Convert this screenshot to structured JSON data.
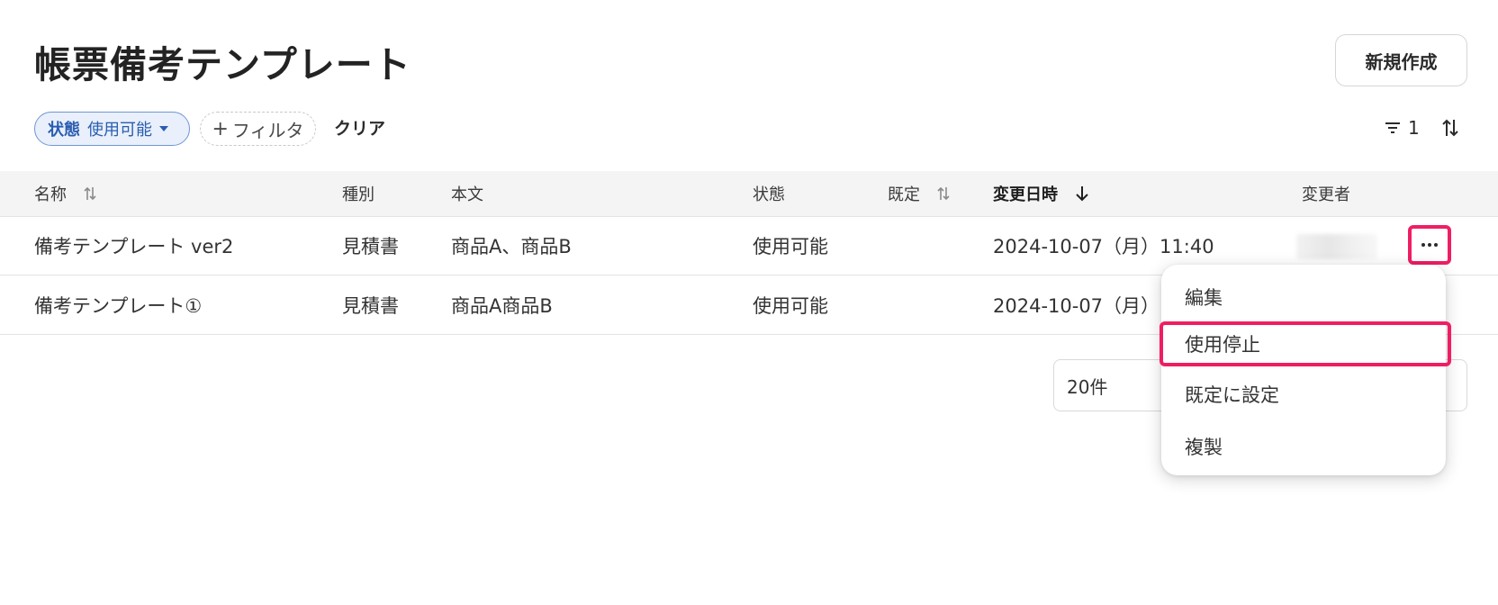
{
  "header": {
    "title": "帳票備考テンプレート",
    "new_button": "新規作成"
  },
  "filters": {
    "chip_key": "状態",
    "chip_value": "使用可能",
    "add_filter": "フィルタ",
    "clear": "クリア",
    "active_count": "1"
  },
  "table": {
    "columns": [
      "名称",
      "種別",
      "本文",
      "状態",
      "既定",
      "変更日時",
      "変更者"
    ],
    "rows": [
      {
        "name": "備考テンプレート ver2",
        "type": "見積書",
        "body": "商品A、商品B",
        "status": "使用可能",
        "default": "",
        "updated": "2024-10-07（月）11:40"
      },
      {
        "name": "備考テンプレート①",
        "type": "見積書",
        "body": "商品A商品B",
        "status": "使用可能",
        "default": "",
        "updated": "2024-10-07（月）"
      }
    ]
  },
  "pagination": {
    "page_size": "20件"
  },
  "row_menu": {
    "items": [
      "編集",
      "使用停止",
      "既定に設定",
      "複製"
    ],
    "highlighted": "使用停止"
  },
  "colors": {
    "highlight": "#ef1e63",
    "chip_accent": "#2a5db0",
    "header_bg": "#f4f4f4"
  }
}
